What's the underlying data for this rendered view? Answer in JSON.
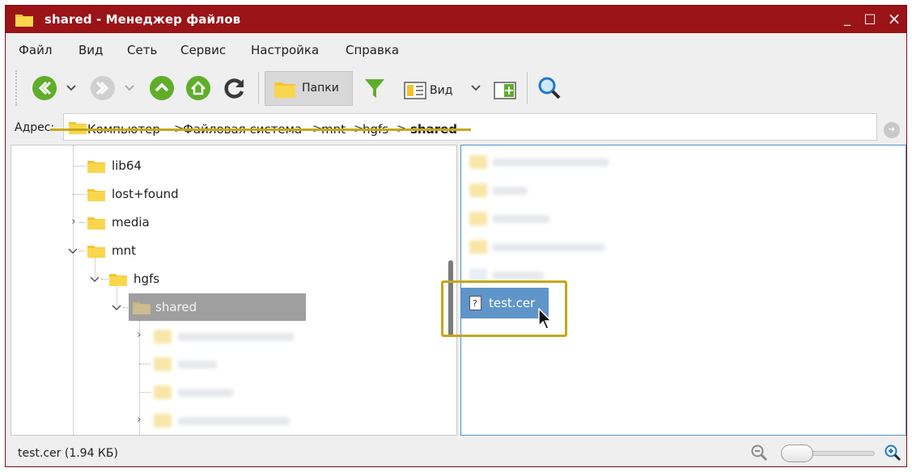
{
  "window": {
    "title": "shared - Менеджер файлов",
    "controls": {
      "minimize": "_",
      "maximize": "□",
      "close": "×"
    }
  },
  "menu": [
    "Файл",
    "Вид",
    "Сеть",
    "Сервис",
    "Настройка",
    "Справка"
  ],
  "toolbar": {
    "back": "arrow-left-icon",
    "forward": "arrow-right-icon",
    "up": "arrow-up-icon",
    "home": "home-icon",
    "refresh": "refresh-icon",
    "folders_label": "Папки",
    "view_label": "Вид",
    "search": "search-icon"
  },
  "address": {
    "label": "Адрес:",
    "crumbs": [
      "Компьютер",
      "Файловая система",
      "mnt",
      "hgfs",
      "shared"
    ],
    "separator": ">"
  },
  "tree": {
    "items": [
      {
        "label": "lib64"
      },
      {
        "label": "lost+found"
      },
      {
        "label": "media"
      },
      {
        "label": "mnt"
      },
      {
        "label": "hgfs"
      },
      {
        "label": "shared"
      }
    ]
  },
  "files": {
    "selected": "test.cer"
  },
  "status": {
    "text": "test.cer (1.94 КБ)"
  },
  "colors": {
    "titlebar": "#9a1317",
    "highlight_outline": "#c4a71a",
    "selection_blue": "#5f95c8",
    "tree_selection": "#9f9f9f"
  }
}
